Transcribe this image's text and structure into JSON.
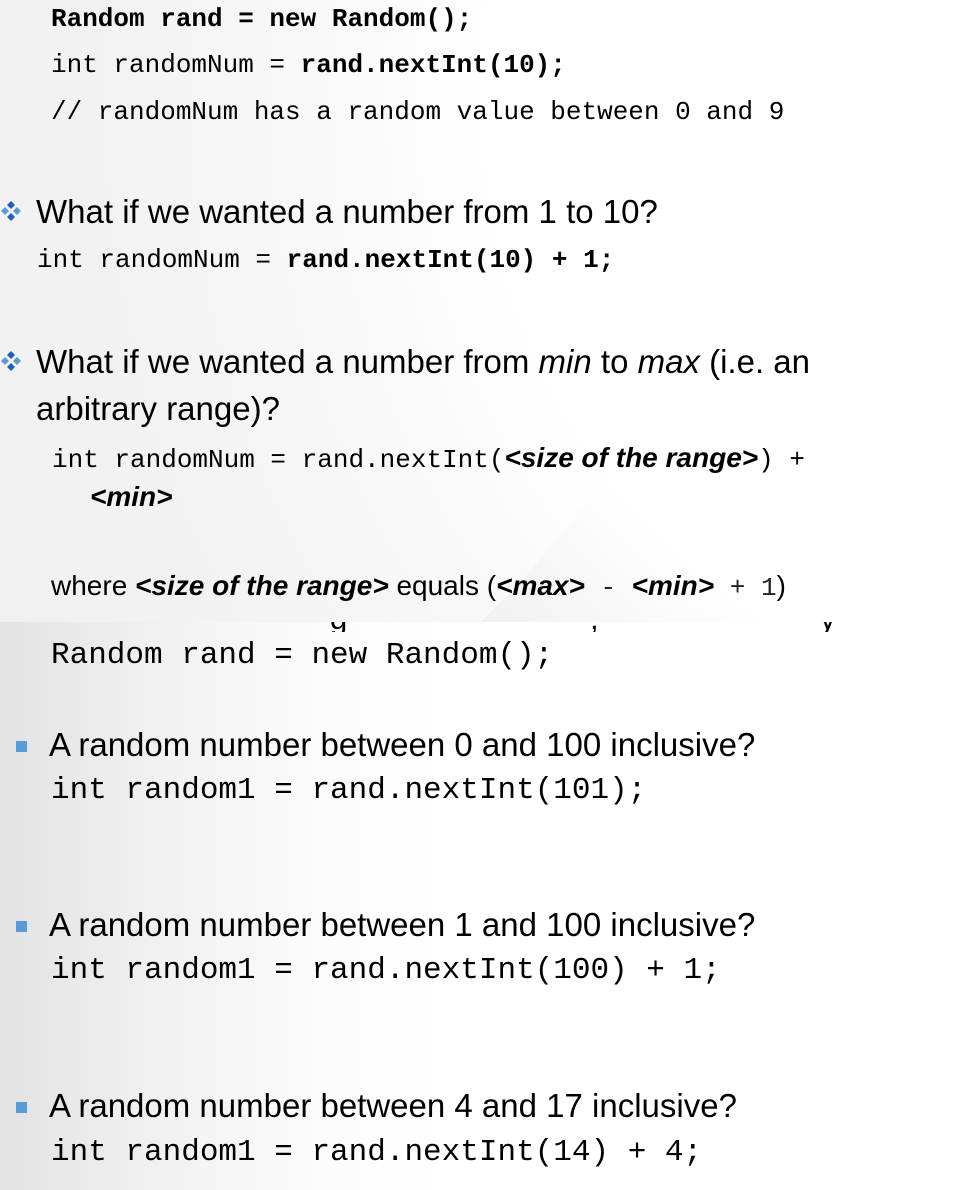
{
  "top": {
    "code1": {
      "bold_stmt": "Random rand = new Random();",
      "line2_plain": "int randomNum = ",
      "line2_bold": "rand.nextInt(10);",
      "line3": "// randomNum has a random value between 0 and 9"
    },
    "bullet1": {
      "text": "What if we wanted a number from 1 to 10?",
      "code_plain": "int randomNum = ",
      "code_bold": "rand.nextInt(10) + 1;"
    },
    "bullet2": {
      "pre": "What if we wanted a number from ",
      "min": "min",
      "mid": " to ",
      "max": "max",
      "post": " (i.e. an",
      "line2": "arbitrary range)?",
      "code_plain": "int randomNum = rand.nextInt(",
      "code_placeholder": "<size of the range>",
      "code_tail": ") +",
      "code_line2": "<min>"
    },
    "where": {
      "lead": "where ",
      "term": "<size of the range>",
      "equals": " equals (",
      "max": "<max>",
      "minus": " - ",
      "min": "<min>",
      "plus": " + 1",
      "close": ")"
    }
  },
  "bottom": {
    "code_line": "Random rand = new Random();",
    "items": [
      {
        "text": "A random number between 0 and 100 inclusive?",
        "code": "int random1 = rand.nextInt(101);"
      },
      {
        "text": "A random number between 1 and 100 inclusive?",
        "code": "int random1 = rand.nextInt(100) + 1;"
      },
      {
        "text": "A random number between 4 and 17 inclusive?",
        "code": "int random1 = rand.nextInt(14) + 4;"
      }
    ]
  }
}
